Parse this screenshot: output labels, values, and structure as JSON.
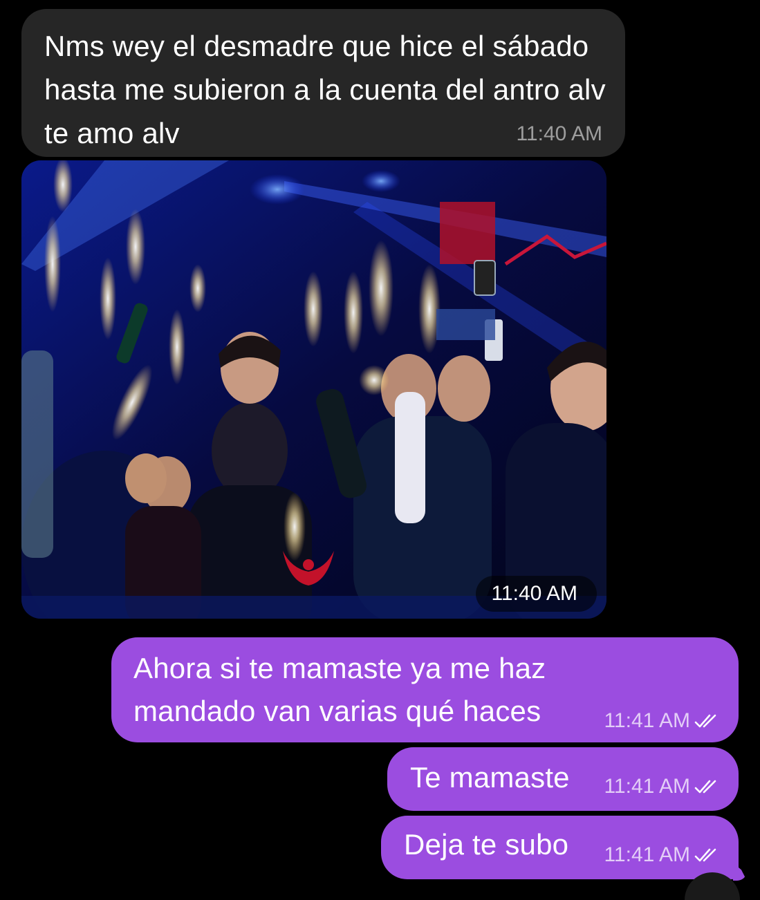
{
  "conversation": {
    "incoming": [
      {
        "text": "Nms wey el desmadre que hice el sábado hasta me subieron a la cuenta del antro alv te amo alv",
        "time": "11:40 AM"
      },
      {
        "type": "photo",
        "time": "11:40 AM"
      }
    ],
    "outgoing": [
      {
        "text": "Ahora si te mamaste ya me haz mandado van varias qué haces",
        "time": "11:41 AM",
        "status": "read-double-check-icon"
      },
      {
        "text": "Te mamaste",
        "time": "11:41 AM",
        "status": "read-double-check-icon"
      },
      {
        "text": "Deja te subo",
        "time": "11:41 AM",
        "status": "read-double-check-icon"
      }
    ]
  },
  "colors": {
    "background": "#000000",
    "incoming_bubble": "#262626",
    "outgoing_bubble": "#9b4de0"
  }
}
